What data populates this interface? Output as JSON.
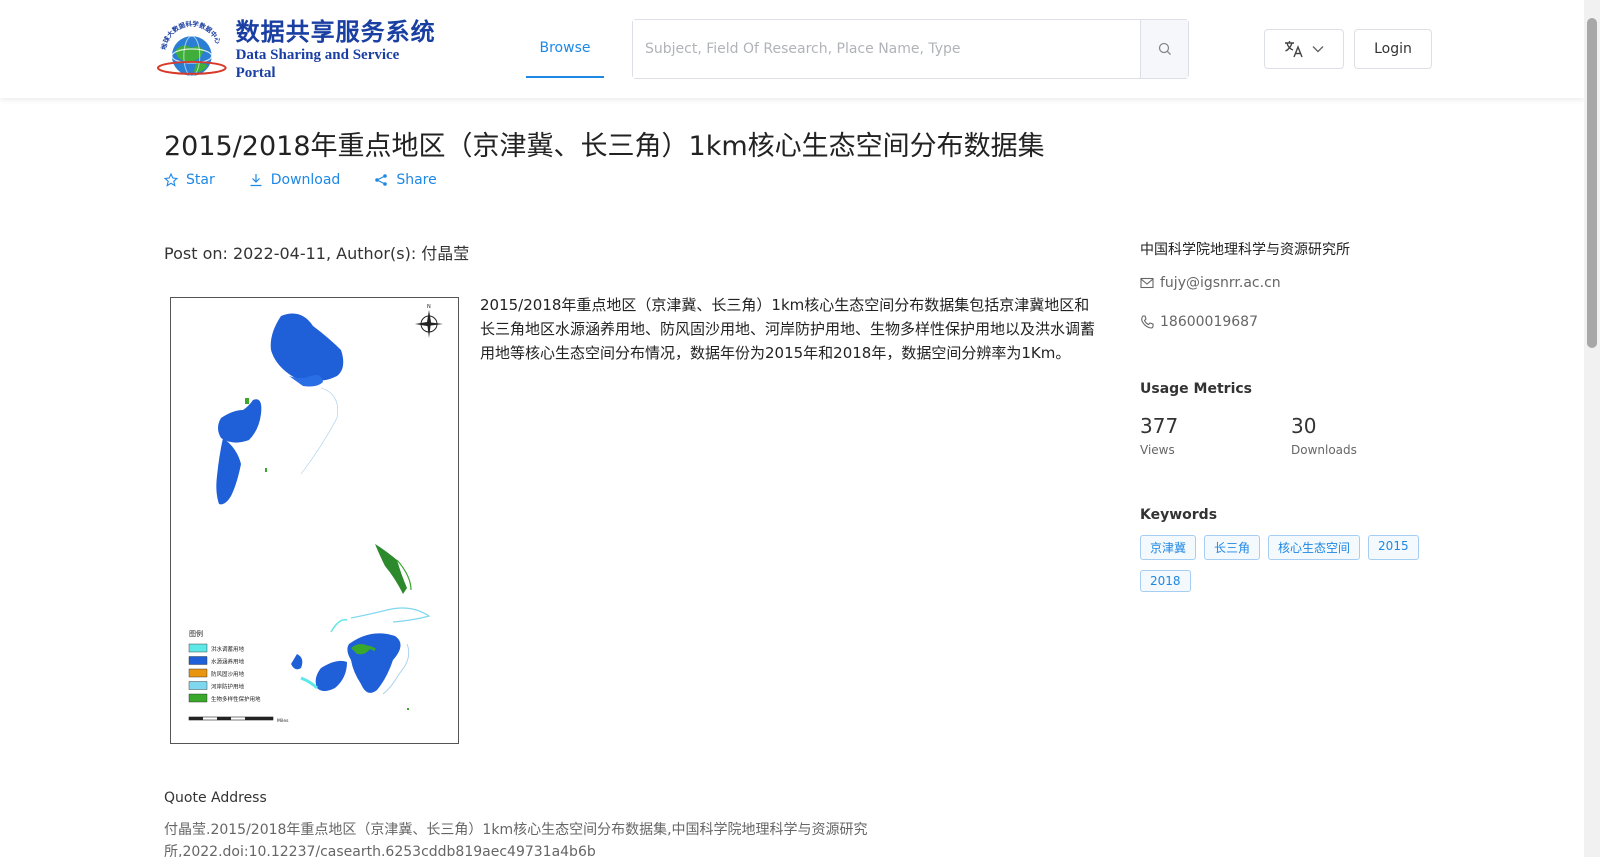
{
  "header": {
    "logo_cn": "数据共享服务系统",
    "logo_en": "Data Sharing and Service Portal",
    "logo_ring_text": "地球大数据科学数据中心",
    "nav_browse": "Browse",
    "search_placeholder": "Subject, Field Of Research, Place Name, Type",
    "login_label": "Login"
  },
  "dataset": {
    "title": "2015/2018年重点地区（京津冀、长三角）1km核心生态空间分布数据集",
    "actions": {
      "star": "Star",
      "download": "Download",
      "share": "Share"
    },
    "post_on": "Post on: 2022-04-11, Author(s): 付晶莹",
    "description": "2015/2018年重点地区（京津冀、长三角）1km核心生态空间分布数据集包括京津冀地区和长三角地区水源涵养用地、防风固沙用地、河岸防护用地、生物多样性保护用地以及洪水调蓄用地等核心生态空间分布情况，数据年份为2015年和2018年，数据空间分辨率为1Km。"
  },
  "sidebar": {
    "organization": "中国科学院地理科学与资源研究所",
    "email": "fujy@igsnrr.ac.cn",
    "phone": "18600019687",
    "usage_title": "Usage Metrics",
    "views_value": "377",
    "views_label": "Views",
    "downloads_value": "30",
    "downloads_label": "Downloads",
    "keywords_title": "Keywords",
    "keywords": [
      "京津冀",
      "长三角",
      "核心生态空间",
      "2015",
      "2018"
    ]
  },
  "map": {
    "legend_title": "图例",
    "legend_items": [
      "洪水调蓄用地",
      "水源涵养用地",
      "防风固沙用地",
      "河岸防护用地",
      "生物多样性保护用地"
    ],
    "legend_colors": [
      "#5ee8e8",
      "#1f5fd8",
      "#e8960f",
      "#7fd7ef",
      "#3aa82a"
    ],
    "scale_label": "Miles"
  },
  "quote": {
    "heading": "Quote Address",
    "text": "付晶莹.2015/2018年重点地区（京津冀、长三角）1km核心生态空间分布数据集,中国科学院地理科学与资源研究所,2022.doi:10.12237/casearth.6253cddb819aec49731a4b6b"
  },
  "colors": {
    "accent": "#1e88e5",
    "brand": "#1a3fa3"
  }
}
